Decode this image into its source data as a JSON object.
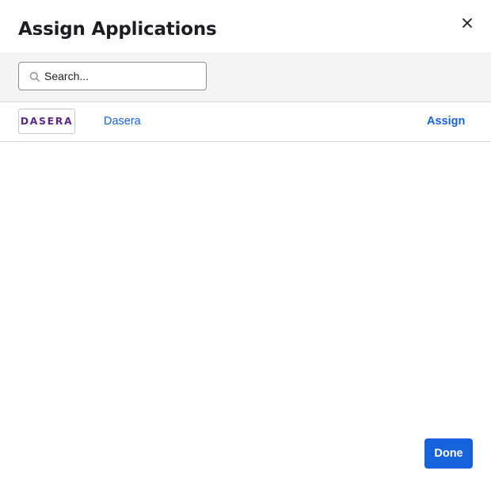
{
  "dialog": {
    "title": "Assign Applications",
    "close_icon": "close-icon"
  },
  "search": {
    "placeholder": "Search...",
    "value": "",
    "icon": "search-icon"
  },
  "apps": [
    {
      "logo_text": "DASERA",
      "name": "Dasera",
      "action_label": "Assign"
    }
  ],
  "footer": {
    "done_label": "Done"
  },
  "colors": {
    "accent": "#1662dd",
    "logo": "#5a2a86",
    "band": "#f4f4f4",
    "divider": "#d7d7dc"
  }
}
